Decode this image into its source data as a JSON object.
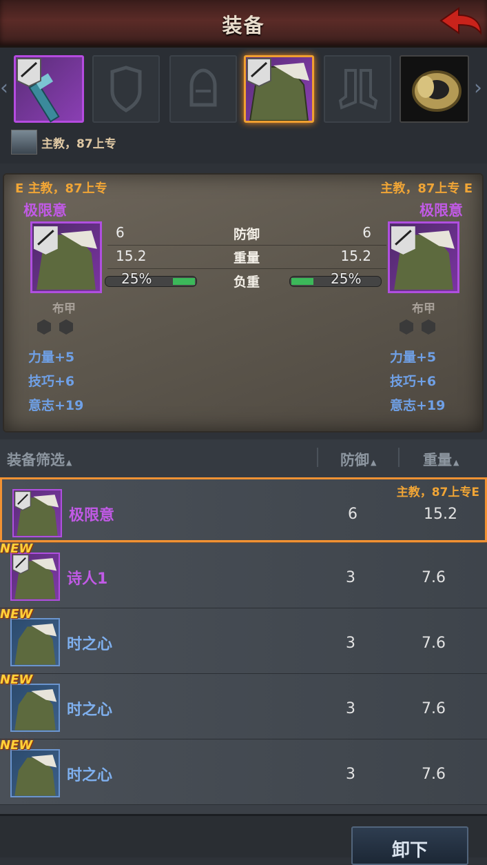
{
  "header": {
    "title": "装备"
  },
  "owner": {
    "text": "主教，87上专"
  },
  "compare": {
    "left": {
      "owner": "E 主教，87上专",
      "name": "极限意",
      "type": "布甲",
      "attrs": [
        "力量+5",
        "技巧+6",
        "意志+19"
      ]
    },
    "right": {
      "owner": "主教，87上专 E",
      "name": "极限意",
      "type": "布甲",
      "attrs": [
        "力量+5",
        "技巧+6",
        "意志+19"
      ]
    },
    "stats": [
      {
        "label": "防御",
        "left": "6",
        "right": "6"
      },
      {
        "label": "重量",
        "left": "15.2",
        "right": "15.2"
      },
      {
        "label": "负重",
        "left": "25%",
        "right": "25%",
        "fraction": 0.25
      }
    ]
  },
  "list_header": {
    "filter": "装备筛选",
    "defense": "防御",
    "weight": "重量"
  },
  "items": [
    {
      "name": "极限意",
      "defense": "6",
      "weight": "15.2",
      "owner": "主教，87上专E",
      "new": "",
      "rarity": "purple",
      "selected": true
    },
    {
      "name": "诗人1",
      "defense": "3",
      "weight": "7.6",
      "owner": "",
      "new": "NEW",
      "rarity": "purple",
      "selected": false
    },
    {
      "name": "时之心",
      "defense": "3",
      "weight": "7.6",
      "owner": "",
      "new": "NEW",
      "rarity": "blue",
      "selected": false
    },
    {
      "name": "时之心",
      "defense": "3",
      "weight": "7.6",
      "owner": "",
      "new": "NEW",
      "rarity": "blue",
      "selected": false
    },
    {
      "name": "时之心",
      "defense": "3",
      "weight": "7.6",
      "owner": "",
      "new": "NEW",
      "rarity": "blue",
      "selected": false
    }
  ],
  "bottom": {
    "unequip": "卸下"
  },
  "colors": {
    "purple": "#c15ae6",
    "blue": "#7fb0ef",
    "orange": "#f0a536",
    "green": "#3cb85a"
  }
}
